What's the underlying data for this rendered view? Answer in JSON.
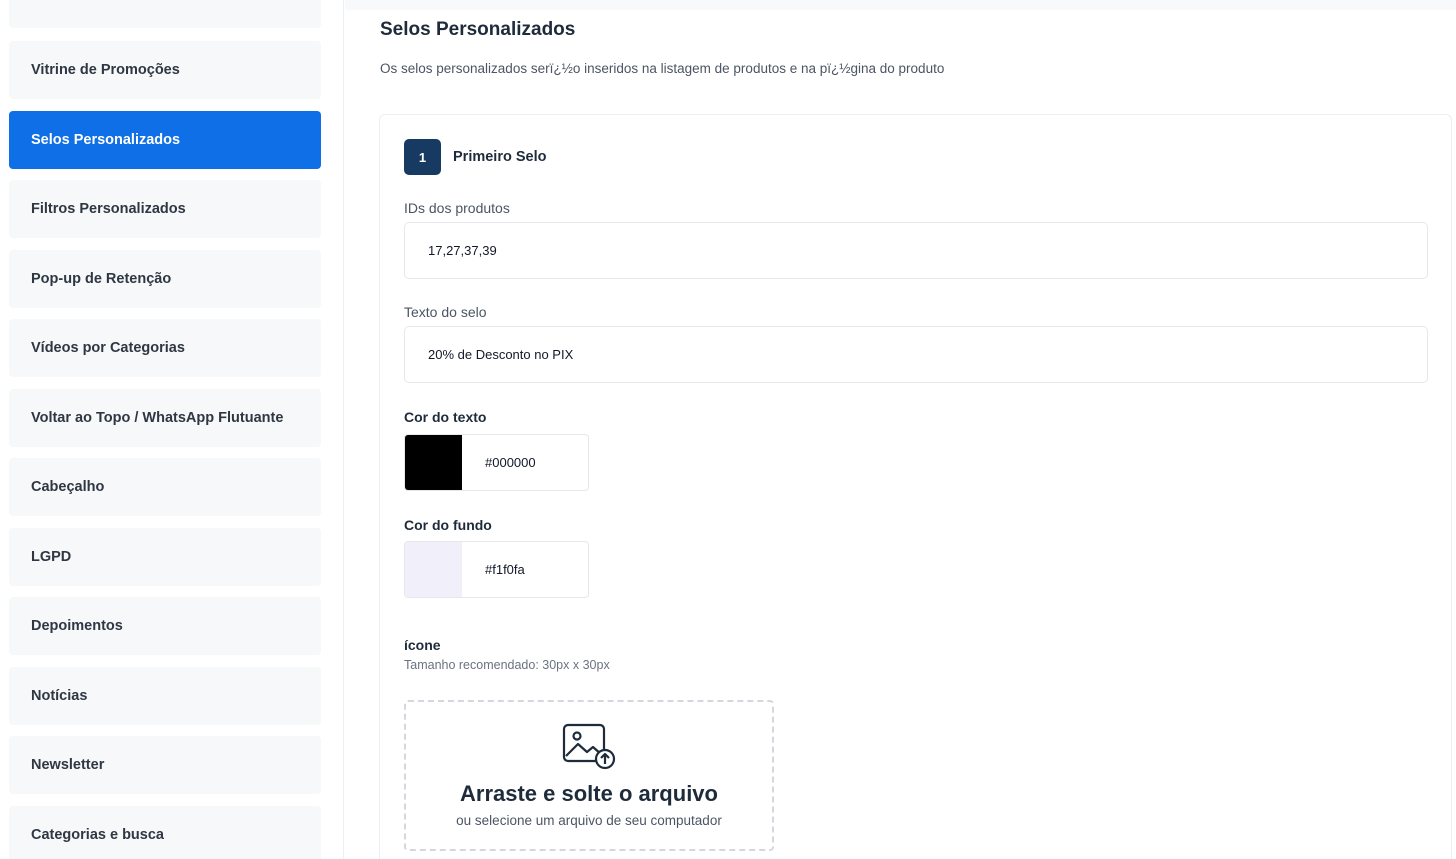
{
  "sidebar": {
    "items": [
      {
        "label": ""
      },
      {
        "label": "Vitrine de Promoções"
      },
      {
        "label": "Selos Personalizados",
        "active": true
      },
      {
        "label": "Filtros Personalizados"
      },
      {
        "label": "Pop-up de Retenção"
      },
      {
        "label": "Vídeos por Categorias"
      },
      {
        "label": "Voltar ao Topo / WhatsApp Flutuante"
      },
      {
        "label": "Cabeçalho"
      },
      {
        "label": "LGPD"
      },
      {
        "label": "Depoimentos"
      },
      {
        "label": "Notícias"
      },
      {
        "label": "Newsletter"
      },
      {
        "label": "Categorias e busca"
      }
    ],
    "active_color": "#0f6fe6"
  },
  "main": {
    "title": "Selos Personalizados",
    "description": "Os selos personalizados serï¿½o inseridos na listagem de produtos e na pï¿½gina do produto",
    "seal": {
      "number": "1",
      "title": "Primeiro Selo",
      "ids_label": "IDs dos produtos",
      "ids_value": "17,27,37,39",
      "text_label": "Texto do selo",
      "text_value": "20% de Desconto no PIX",
      "text_color_label": "Cor do texto",
      "text_color_value": "#000000",
      "bg_color_label": "Cor do fundo",
      "bg_color_value": "#f1f0fa",
      "icon_label": "ícone",
      "icon_hint": "Tamanho recomendado: 30px x 30px",
      "upload_title": "Arraste e solte o arquivo",
      "upload_subtitle": "ou selecione um arquivo de seu computador"
    }
  }
}
